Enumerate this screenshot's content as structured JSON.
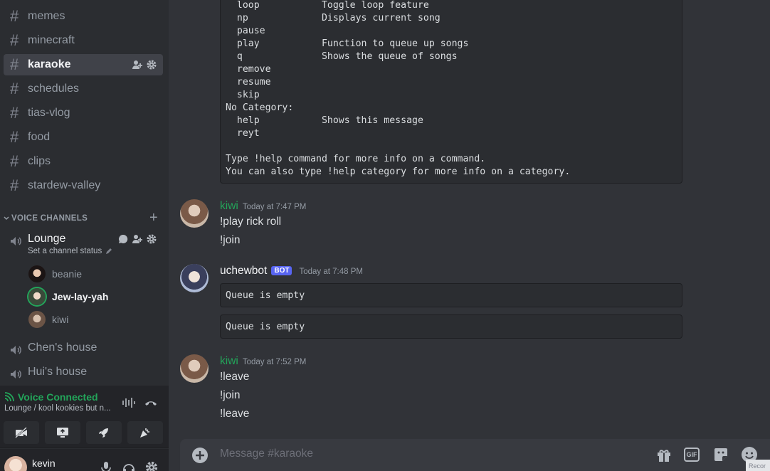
{
  "sidebar": {
    "text_channels": [
      {
        "name": "memes",
        "active": false
      },
      {
        "name": "minecraft",
        "active": false
      },
      {
        "name": "karaoke",
        "active": true
      },
      {
        "name": "schedules",
        "active": false
      },
      {
        "name": "tias-vlog",
        "active": false
      },
      {
        "name": "food",
        "active": false
      },
      {
        "name": "clips",
        "active": false
      },
      {
        "name": "stardew-valley",
        "active": false
      }
    ],
    "voice_category": "VOICE CHANNELS",
    "voice_channels": [
      {
        "name": "Lounge",
        "status": "Set a channel status"
      },
      {
        "name": "Chen's house"
      },
      {
        "name": "Hui's house"
      }
    ],
    "lounge_users": [
      {
        "name": "beanie",
        "speaking": false
      },
      {
        "name": "Jew-lay-yah",
        "speaking": true
      },
      {
        "name": "kiwi",
        "speaking": false
      }
    ]
  },
  "voice_panel": {
    "status": "Voice Connected",
    "location": "Lounge / kool kookies but n..."
  },
  "user": {
    "name": "kevin"
  },
  "chat": {
    "help_output": "  loop           Toggle loop feature\n  np             Displays current song\n  pause\n  play           Function to queue up songs\n  q              Shows the queue of songs\n  remove\n  resume\n  skip\nNo Category:\n  help           Shows this message\n  reyt\n\nType !help command for more info on a command.\nYou can also type !help category for more info on a category.",
    "messages": [
      {
        "author": "kiwi",
        "time": "Today at 7:47 PM",
        "lines": [
          "!play rick roll",
          "!join"
        ]
      },
      {
        "author": "uchewbot",
        "bot_badge": "BOT",
        "time": "Today at 7:48 PM",
        "embeds": [
          "Queue is empty",
          "Queue is empty"
        ]
      },
      {
        "author": "kiwi",
        "time": "Today at 7:52 PM",
        "lines": [
          "!leave",
          "!join",
          "!leave"
        ]
      }
    ],
    "input_placeholder": "Message #karaoke",
    "gif_label": "GIF",
    "corner_label": "Recor"
  },
  "colors": {
    "kiwi": "#23a55a",
    "uchewbot": "#f2f3f5",
    "accent": "#5865f2",
    "connected": "#23a55a"
  }
}
